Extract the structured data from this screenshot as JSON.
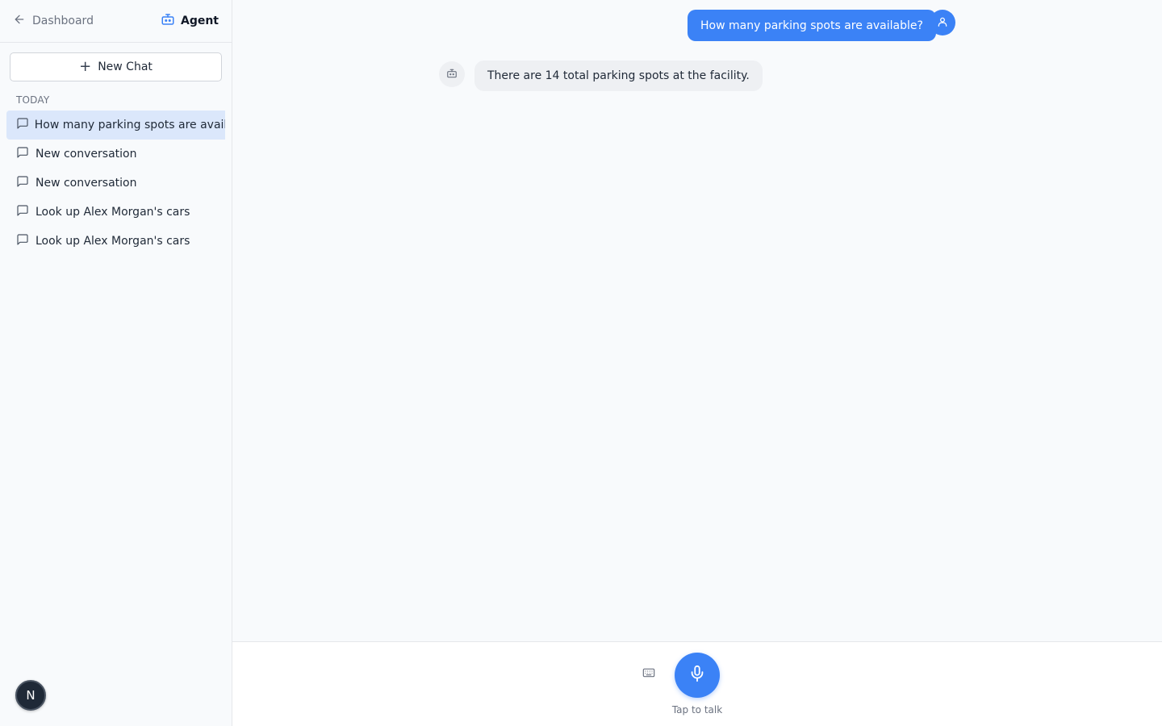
{
  "sidebar": {
    "back_label": "Dashboard",
    "agent_label": "Agent",
    "new_chat_label": "New Chat",
    "section_label": "TODAY",
    "conversations": [
      {
        "label": "How many parking spots are availab",
        "active": true
      },
      {
        "label": "New conversation",
        "active": false
      },
      {
        "label": "New conversation",
        "active": false
      },
      {
        "label": "Look up Alex Morgan's cars",
        "active": false
      },
      {
        "label": "Look up Alex Morgan's cars",
        "active": false
      }
    ],
    "user_initial": "N"
  },
  "chat": {
    "messages": [
      {
        "role": "user",
        "text": "How many parking spots are available?"
      },
      {
        "role": "assistant",
        "text": "There are 14 total parking spots at the facility."
      }
    ]
  },
  "footer": {
    "tap_label": "Tap to talk"
  },
  "icons": {
    "back": "arrow-left-icon",
    "agent": "robot-icon",
    "plus": "plus-icon",
    "conversation": "message-square-icon",
    "user": "user-icon",
    "bot": "robot-icon",
    "keyboard": "keyboard-icon",
    "mic": "microphone-icon"
  },
  "colors": {
    "accent": "#3b82f6",
    "active_item_bg": "#dbe7fb",
    "assistant_bubble_bg": "#eef0f3"
  }
}
